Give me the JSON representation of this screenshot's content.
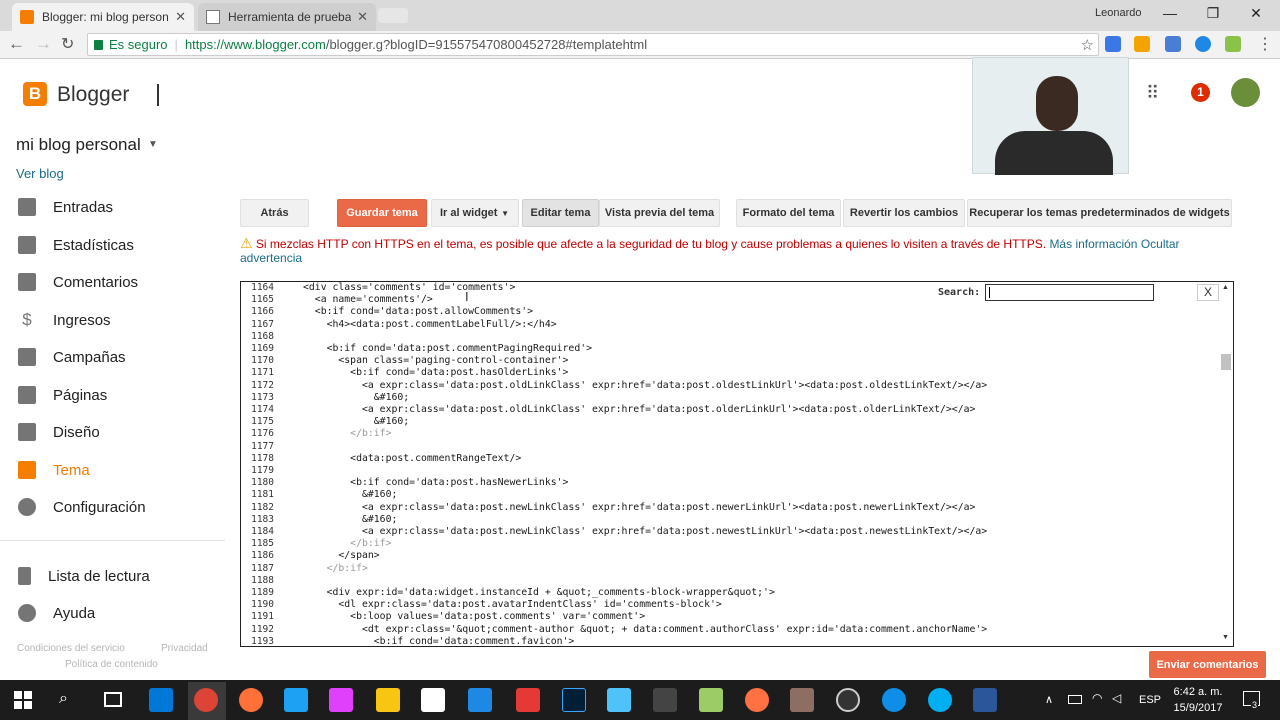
{
  "browser": {
    "tabs": [
      {
        "title": "Blogger: mi blog personal"
      },
      {
        "title": "Herramienta de pruebas"
      }
    ],
    "profile_name": "Leonardo",
    "secure_label": "Es seguro",
    "url_host": "https://www.blogger.com",
    "url_path": "/blogger.g?blogID=915575470800452728#templatehtml"
  },
  "header": {
    "brand": "Blogger",
    "notification_count": "1"
  },
  "sidebar": {
    "blog_name": "mi blog personal",
    "view_blog": "Ver blog",
    "items": [
      {
        "label": "Entradas",
        "icon": "posts-icon"
      },
      {
        "label": "Estadísticas",
        "icon": "stats-icon"
      },
      {
        "label": "Comentarios",
        "icon": "comments-icon"
      },
      {
        "label": "Ingresos",
        "icon": "dollar-icon"
      },
      {
        "label": "Campañas",
        "icon": "ads-icon"
      },
      {
        "label": "Páginas",
        "icon": "pages-icon"
      },
      {
        "label": "Diseño",
        "icon": "layout-icon"
      },
      {
        "label": "Tema",
        "icon": "theme-icon"
      },
      {
        "label": "Configuración",
        "icon": "gear-icon"
      },
      {
        "label": "Lista de lectura",
        "icon": "bookmark-icon"
      },
      {
        "label": "Ayuda",
        "icon": "help-icon"
      }
    ],
    "footer": {
      "terms": "Condiciones del servicio",
      "privacy": "Privacidad",
      "content_policy": "Política de contenido"
    }
  },
  "toolbar": {
    "back": "Atrás",
    "save": "Guardar tema",
    "go_widget": "Ir al widget",
    "edit": "Editar tema",
    "preview": "Vista previa del tema",
    "format": "Formato del tema",
    "revert": "Revertir los cambios",
    "restore": "Recuperar los temas predeterminados de widgets"
  },
  "warning": {
    "text": "Si mezclas HTTP con HTTPS en el tema, es posible que afecte a la seguridad de tu blog y cause problemas a quienes lo visiten a través de HTTPS.",
    "more": "Más información",
    "hide": "Ocultar advertencia"
  },
  "search": {
    "label": "Search:",
    "close": "X"
  },
  "editor": {
    "line_numbers": [
      "1164",
      "1165",
      "1166",
      "1167",
      "1168",
      "1169",
      "1170",
      "1171",
      "1172",
      "1173",
      "1174",
      "1175",
      "1176",
      "1177",
      "1178",
      "1179",
      "1180",
      "1181",
      "1182",
      "1183",
      "1184",
      "1185",
      "1186",
      "1187",
      "1188",
      "1189",
      "1190",
      "1191",
      "1192",
      "1193"
    ]
  },
  "feedback": "Enviar comentarios",
  "taskbar": {
    "lang": "ESP",
    "time": "6:42 a. m.",
    "date": "15/9/2017",
    "notifications": "3"
  },
  "colors": {
    "accent": "#f57d00",
    "save_button": "#ea6a47",
    "link": "#1a6d89",
    "warning": "#c00000"
  }
}
